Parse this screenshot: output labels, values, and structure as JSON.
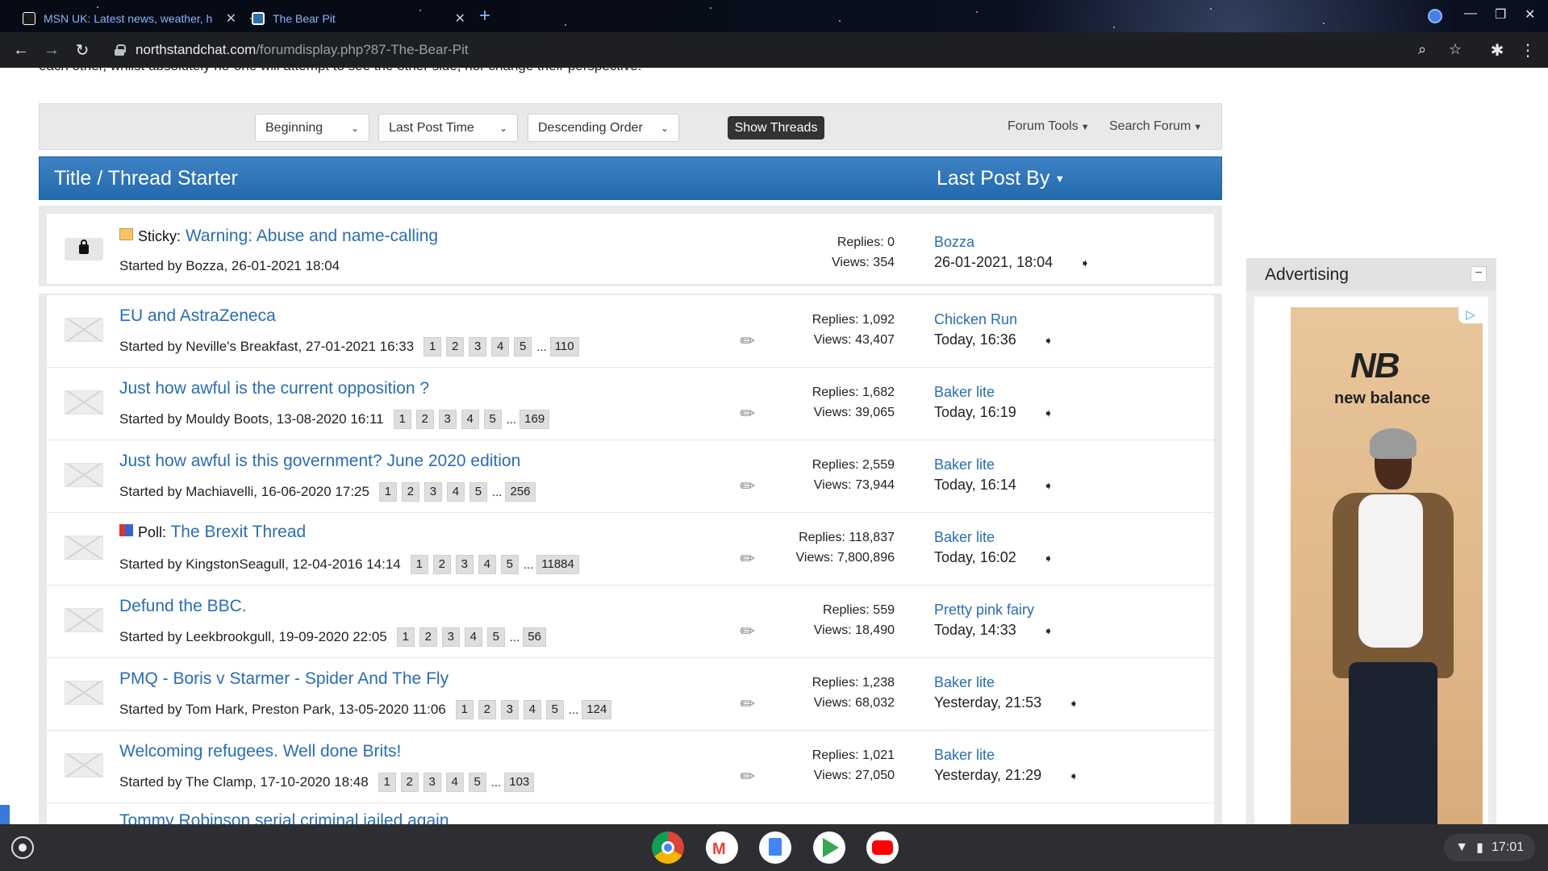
{
  "browser": {
    "tabs": [
      {
        "title": "MSN UK: Latest news, weather, h",
        "active": false
      },
      {
        "title": "The Bear Pit",
        "active": true
      }
    ],
    "url_host": "northstandchat.com",
    "url_path": "/forumdisplay.php?87-The-Bear-Pit"
  },
  "page": {
    "intro_text": "each other, whilst absolutely no-one will attempt to see the other side, nor change their perspective."
  },
  "filters": {
    "prefix": "Beginning",
    "sort_by": "Last Post Time",
    "order": "Descending Order",
    "show_button": "Show Threads",
    "forum_tools": "Forum Tools",
    "search_forum": "Search Forum"
  },
  "table_header": {
    "title": "Title / Thread Starter",
    "last_post": "Last Post By"
  },
  "sticky": {
    "prefix": "Sticky:",
    "title": "Warning: Abuse and name-calling",
    "starter": "Started by Bozza, 26-01-2021 18:04",
    "replies": "Replies: 0",
    "views": "Views: 354",
    "last_by": "Bozza",
    "last_time": "26-01-2021, 18:04"
  },
  "threads": [
    {
      "prefix": "",
      "title": "EU and AstraZeneca",
      "starter": "Started by Neville's Breakfast, 27-01-2021 16:33",
      "pages": [
        "1",
        "2",
        "3",
        "4",
        "5"
      ],
      "last_page": "110",
      "replies": "Replies: 1,092",
      "views": "Views: 43,407",
      "last_by": "Chicken Run",
      "last_time": "Today, 16:36"
    },
    {
      "prefix": "",
      "title": "Just how awful is the current opposition ?",
      "starter": "Started by Mouldy Boots, 13-08-2020 16:11",
      "pages": [
        "1",
        "2",
        "3",
        "4",
        "5"
      ],
      "last_page": "169",
      "replies": "Replies: 1,682",
      "views": "Views: 39,065",
      "last_by": "Baker lite",
      "last_time": "Today, 16:19"
    },
    {
      "prefix": "",
      "title": "Just how awful is this government? June 2020 edition",
      "starter": "Started by Machiavelli, 16-06-2020 17:25",
      "pages": [
        "1",
        "2",
        "3",
        "4",
        "5"
      ],
      "last_page": "256",
      "replies": "Replies: 2,559",
      "views": "Views: 73,944",
      "last_by": "Baker lite",
      "last_time": "Today, 16:14"
    },
    {
      "prefix": "Poll:",
      "title": "The Brexit Thread",
      "starter": "Started by KingstonSeagull, 12-04-2016 14:14",
      "pages": [
        "1",
        "2",
        "3",
        "4",
        "5"
      ],
      "last_page": "11884",
      "replies": "Replies: 118,837",
      "views": "Views: 7,800,896",
      "last_by": "Baker lite",
      "last_time": "Today, 16:02"
    },
    {
      "prefix": "",
      "title": "Defund the BBC.",
      "starter": "Started by Leekbrookgull, 19-09-2020 22:05",
      "pages": [
        "1",
        "2",
        "3",
        "4",
        "5"
      ],
      "last_page": "56",
      "replies": "Replies: 559",
      "views": "Views: 18,490",
      "last_by": "Pretty pink fairy",
      "last_time": "Today, 14:33"
    },
    {
      "prefix": "",
      "title": "PMQ - Boris v Starmer - Spider And The Fly",
      "starter": "Started by Tom Hark, Preston Park, 13-05-2020 11:06",
      "pages": [
        "1",
        "2",
        "3",
        "4",
        "5"
      ],
      "last_page": "124",
      "replies": "Replies: 1,238",
      "views": "Views: 68,032",
      "last_by": "Baker lite",
      "last_time": "Yesterday, 21:53"
    },
    {
      "prefix": "",
      "title": "Welcoming refugees. Well done Brits!",
      "starter": "Started by The Clamp, 17-10-2020 18:48",
      "pages": [
        "1",
        "2",
        "3",
        "4",
        "5"
      ],
      "last_page": "103",
      "replies": "Replies: 1,021",
      "views": "Views: 27,050",
      "last_by": "Baker lite",
      "last_time": "Yesterday, 21:29"
    }
  ],
  "cutoff_thread_title": "Tommy Robinson serial criminal jailed again",
  "sidebar": {
    "ad_title": "Advertising",
    "ad_brand": "new balance"
  },
  "shelf": {
    "apps": [
      "chrome-icon",
      "gmail-icon",
      "docs-icon",
      "play-store-icon",
      "youtube-icon"
    ],
    "clock": "17:01"
  },
  "colors": {
    "link": "#2a6db3",
    "header_blue": "#2b6fb2"
  }
}
